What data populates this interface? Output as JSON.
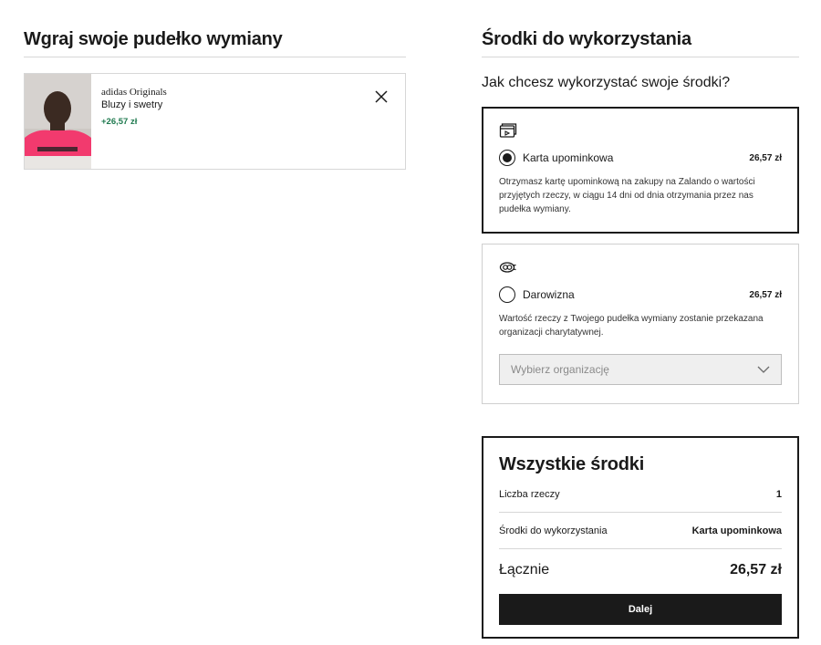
{
  "left": {
    "title": "Wgraj swoje pudełko wymiany",
    "item": {
      "brand": "adidas Originals",
      "category": "Bluzy i swetry",
      "value": "+26,57 zł",
      "photo_icon": "product-photo",
      "remove_icon": "close-icon"
    }
  },
  "right": {
    "title": "Środki do wykorzystania",
    "question": "Jak chcesz wykorzystać swoje środki?",
    "options": [
      {
        "icon": "gift-card-icon",
        "label": "Karta upominkowa",
        "amount": "26,57 zł",
        "selected": true,
        "description": "Otrzymasz kartę upominkową na zakupy na Zalando o wartości przyjętych rzeczy, w ciągu 14 dni od dnia otrzymania przez nas pudełka wymiany."
      },
      {
        "icon": "donation-icon",
        "label": "Darowizna",
        "amount": "26,57 zł",
        "selected": false,
        "description": "Wartość rzeczy z Twojego pudełka wymiany zostanie przekazana organizacji charytatywnej.",
        "select_placeholder": "Wybierz organizację"
      }
    ],
    "summary": {
      "title": "Wszystkie środki",
      "rows": [
        {
          "label": "Liczba rzeczy",
          "value": "1"
        },
        {
          "label": "Środki do wykorzystania",
          "value": "Karta upominkowa"
        }
      ],
      "total_label": "Łącznie",
      "total_value": "26,57 zł",
      "button_label": "Dalej"
    }
  },
  "colors": {
    "accent_green": "#1f7a4f",
    "dark": "#1a1a1a",
    "border": "#d7d7d7",
    "shirt_pink": "#f23a6e"
  }
}
